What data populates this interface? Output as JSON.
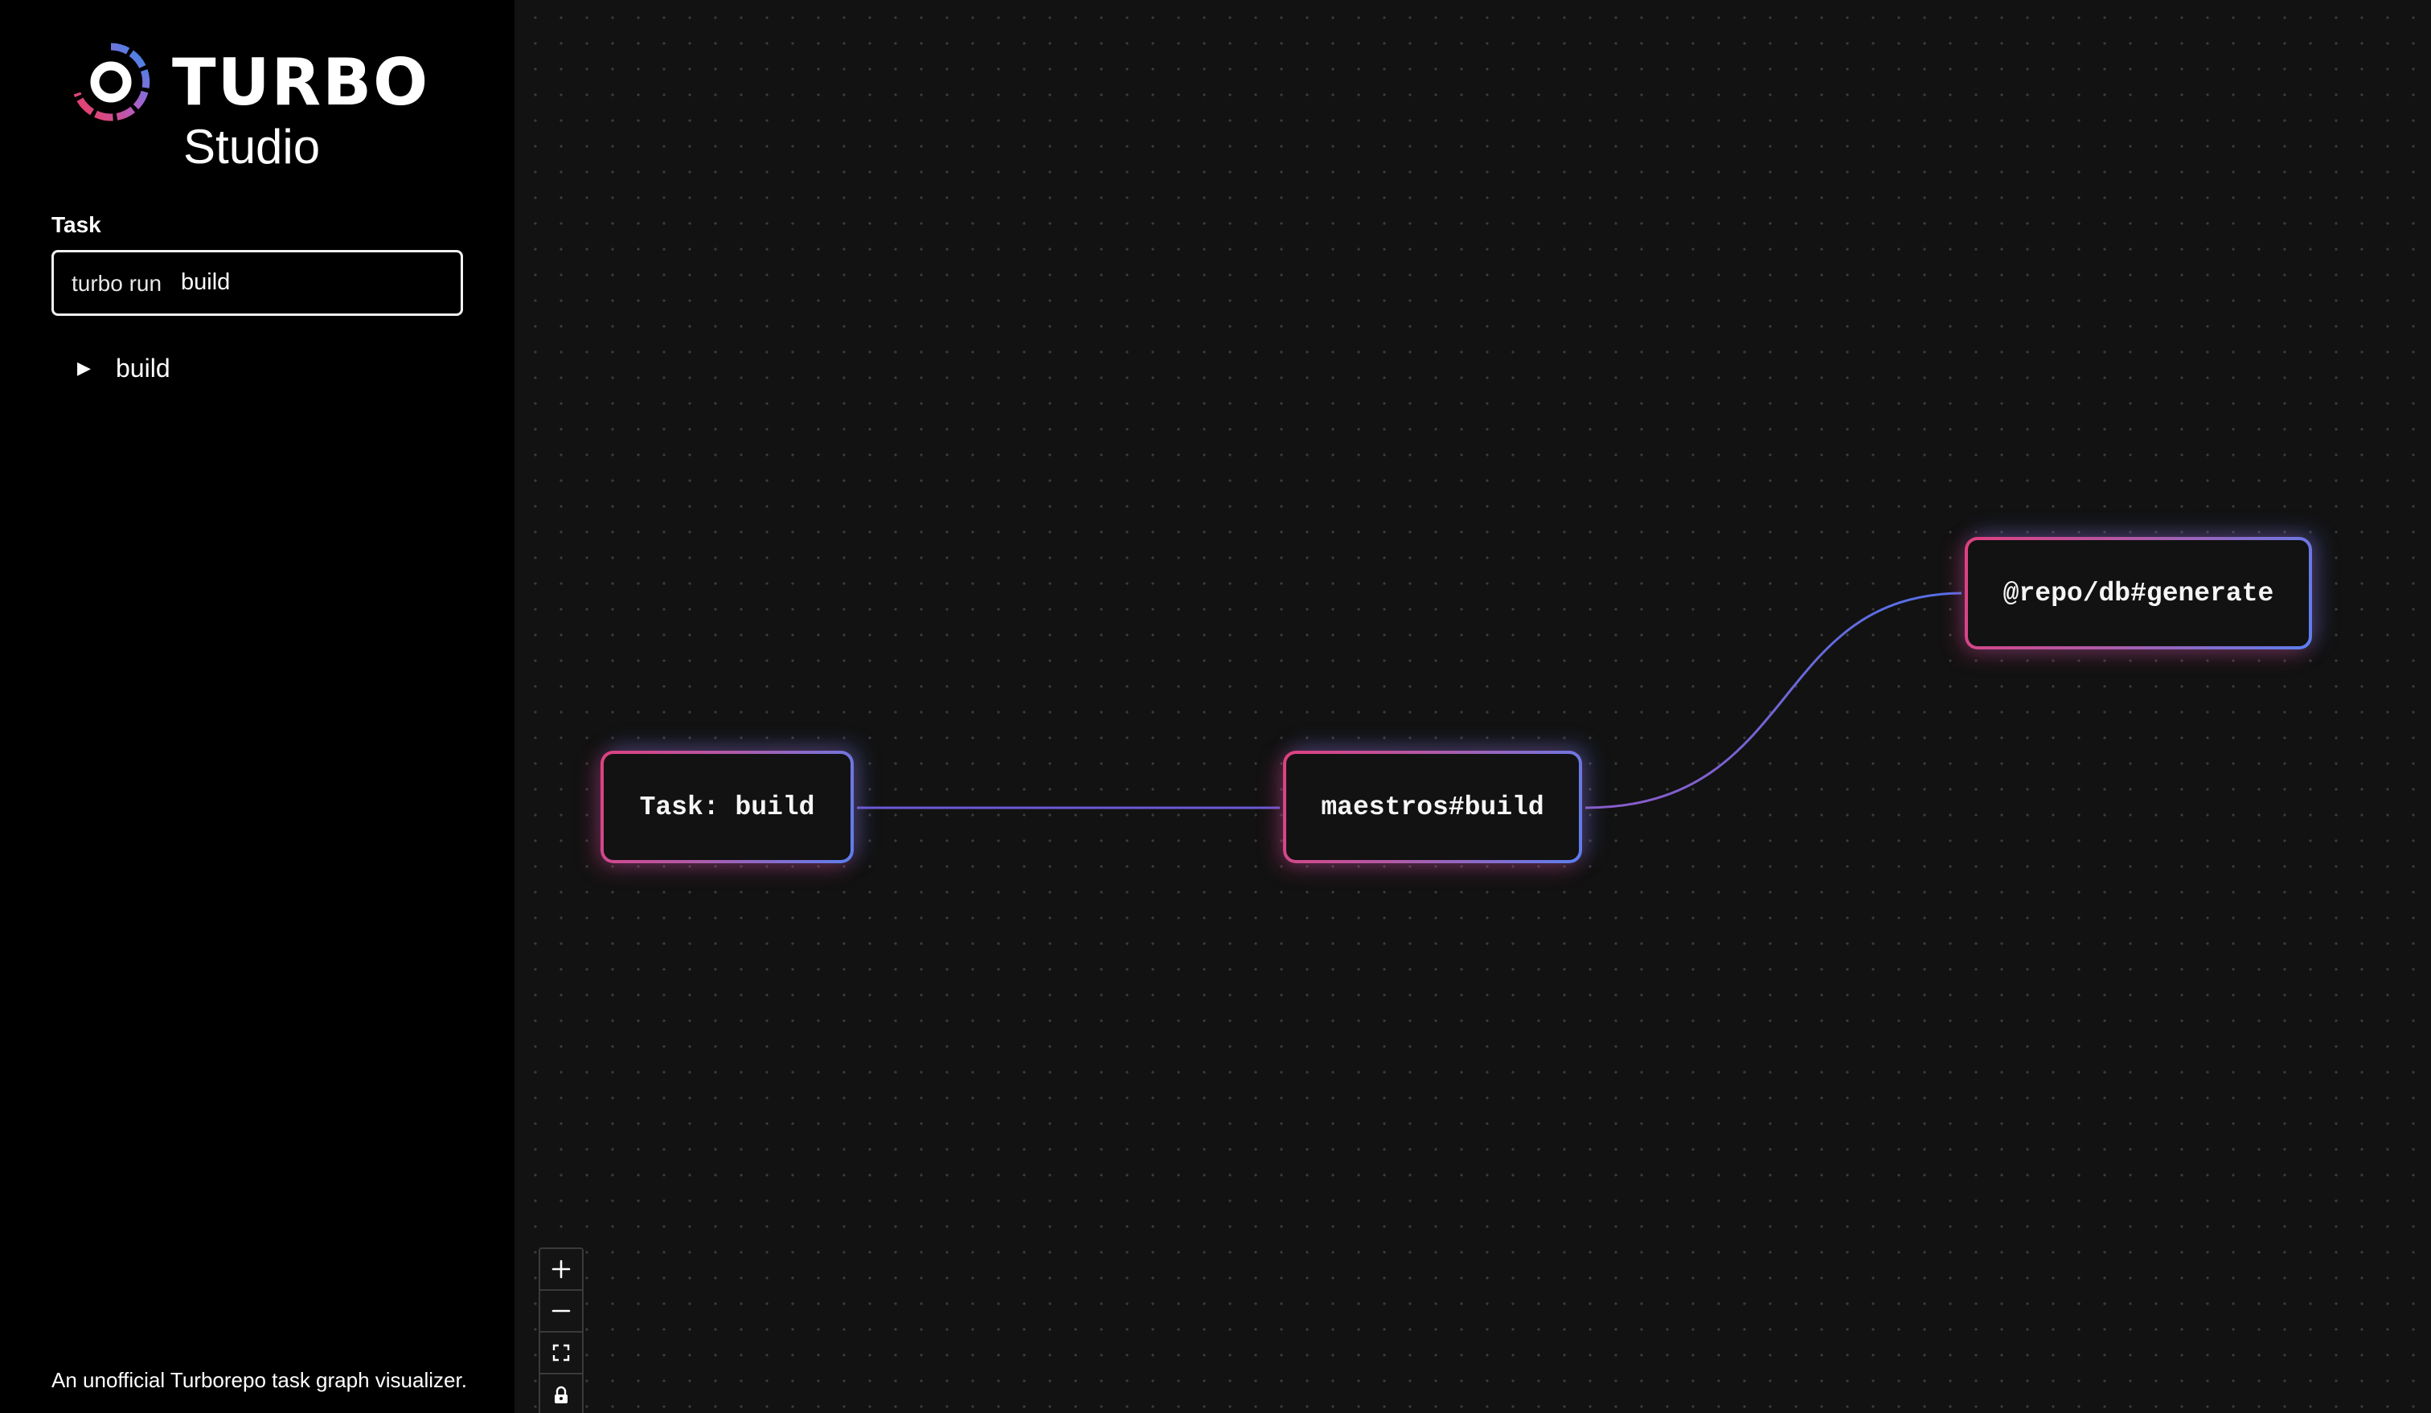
{
  "sidebar": {
    "brand": {
      "name": "TURBO",
      "product": "Studio"
    },
    "task": {
      "label": "Task",
      "command_prefix": "turbo run",
      "input_value": "build"
    },
    "tree": [
      {
        "label": "build",
        "expanded": false
      }
    ],
    "footer": "An unofficial Turborepo task graph visualizer."
  },
  "graph": {
    "nodes": [
      {
        "id": "root",
        "label": "Task: build"
      },
      {
        "id": "maestros-build",
        "label": "maestros#build"
      },
      {
        "id": "db-generate",
        "label": "@repo/db#generate"
      }
    ],
    "edges": [
      {
        "from": "root",
        "to": "maestros-build"
      },
      {
        "from": "maestros-build",
        "to": "db-generate"
      }
    ]
  },
  "controls": [
    {
      "name": "zoom-in",
      "icon": "plus-icon"
    },
    {
      "name": "zoom-out",
      "icon": "minus-icon"
    },
    {
      "name": "fit-view",
      "icon": "fit-view-icon"
    },
    {
      "name": "lock",
      "icon": "lock-icon"
    }
  ],
  "colors": {
    "node_gradient_start": "#e0407f",
    "node_gradient_end": "#5b7ff0",
    "sidebar_bg": "#000000",
    "canvas_bg": "#121212"
  }
}
